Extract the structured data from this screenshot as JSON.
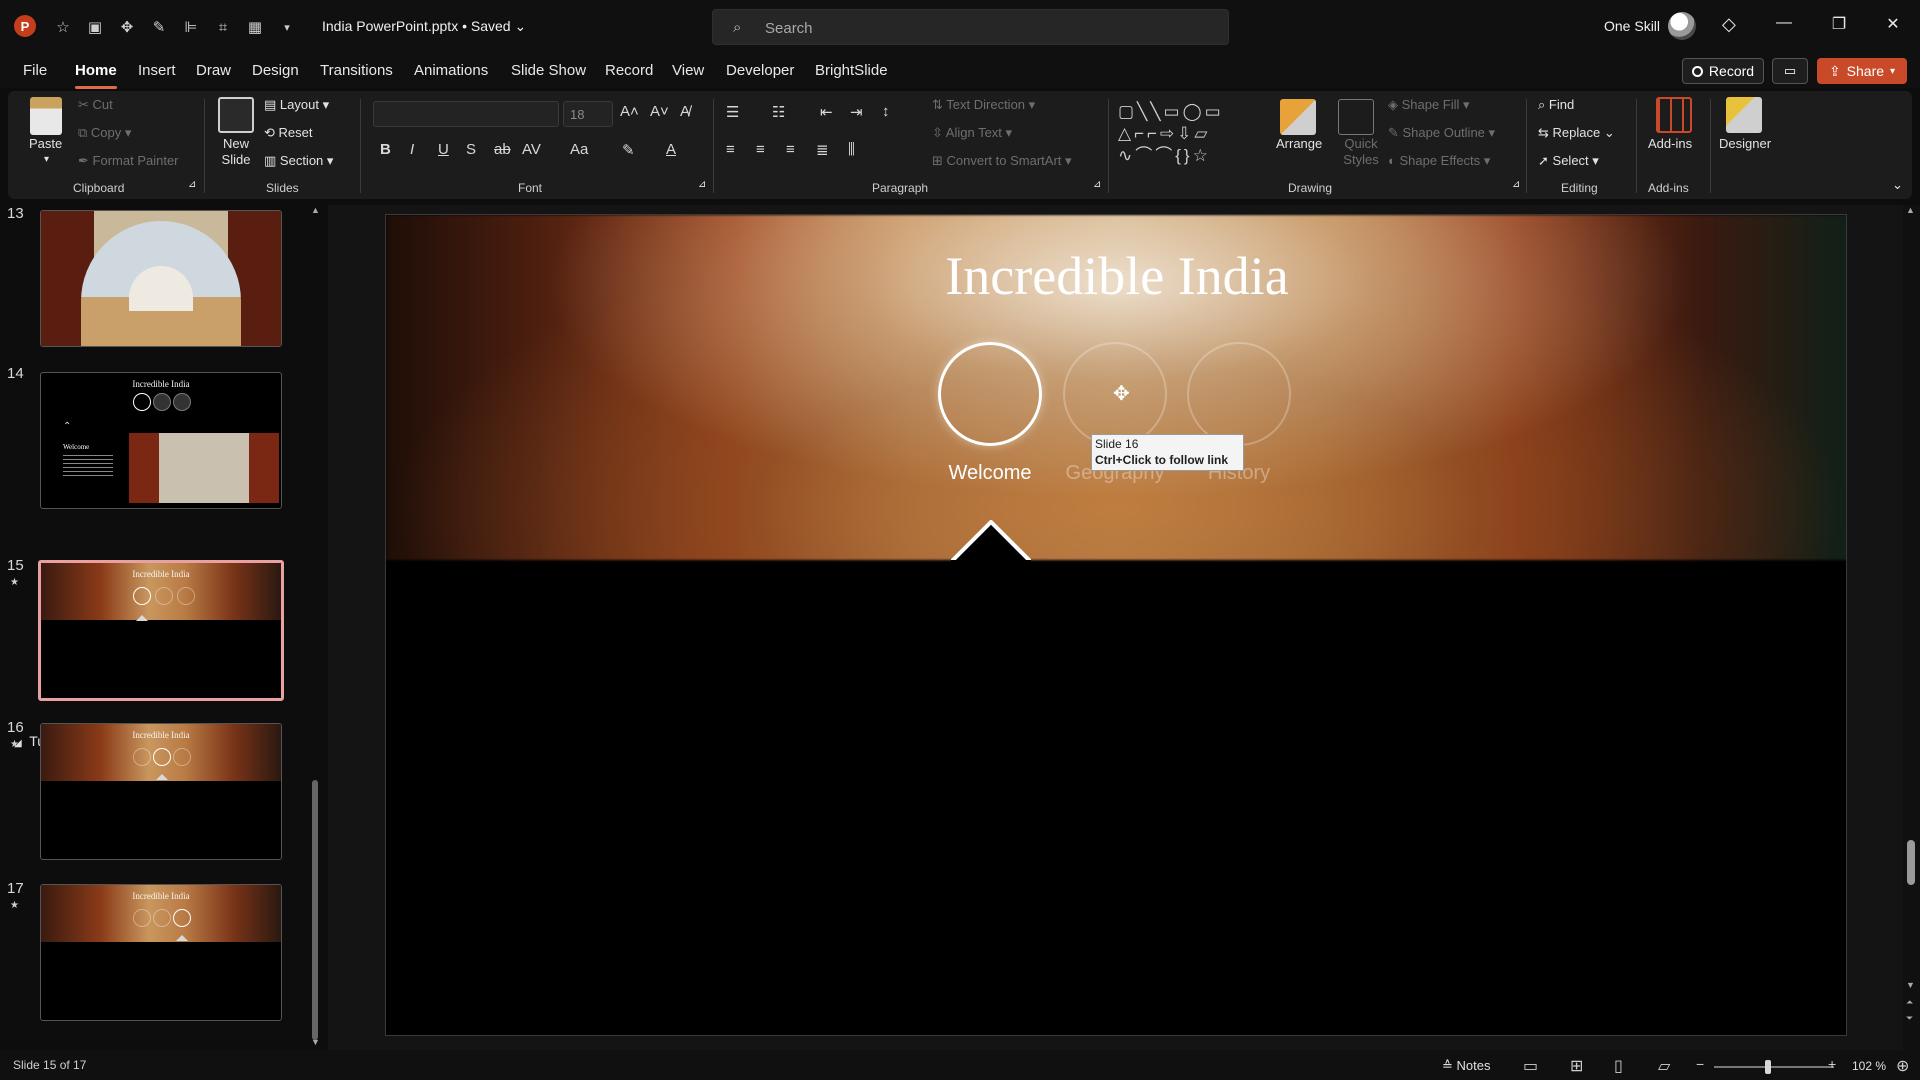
{
  "titlebar": {
    "app_logo": "P",
    "document_title": "India PowerPoint.pptx • Saved",
    "search_placeholder": "Search",
    "user_name": "One Skill"
  },
  "menu": {
    "tabs": [
      "File",
      "Home",
      "Insert",
      "Draw",
      "Design",
      "Transitions",
      "Animations",
      "Slide Show",
      "Record",
      "View",
      "Developer",
      "BrightSlide"
    ],
    "active_tab": "Home",
    "record_button": "Record",
    "share_button": "Share"
  },
  "ribbon": {
    "clipboard": {
      "paste": "Paste",
      "cut": "Cut",
      "copy": "Copy",
      "format_painter": "Format Painter",
      "label": "Clipboard"
    },
    "slides": {
      "new_slide": "New Slide",
      "layout": "Layout",
      "reset": "Reset",
      "section": "Section",
      "label": "Slides"
    },
    "font": {
      "font_size": "18",
      "label": "Font"
    },
    "paragraph": {
      "text_direction": "Text Direction",
      "align_text": "Align Text",
      "convert_smartart": "Convert to SmartArt",
      "label": "Paragraph"
    },
    "drawing": {
      "arrange": "Arrange",
      "quick_styles": "Quick Styles",
      "shape_fill": "Shape Fill",
      "shape_outline": "Shape Outline",
      "shape_effects": "Shape Effects",
      "label": "Drawing"
    },
    "editing": {
      "find": "Find",
      "replace": "Replace",
      "select": "Select",
      "label": "Editing"
    },
    "addins": {
      "addins": "Add-ins",
      "label": "Add-ins"
    },
    "designer": {
      "designer": "Designer"
    }
  },
  "thumbnails": {
    "section_name": "Tutorial",
    "slides": [
      {
        "number": "13"
      },
      {
        "number": "14",
        "title": "Incredible India",
        "welcome_heading": "Welcome"
      },
      {
        "number": "15",
        "title": "Incredible India",
        "selected": true
      },
      {
        "number": "16",
        "title": "Incredible India"
      },
      {
        "number": "17",
        "title": "Incredible India"
      }
    ]
  },
  "slide": {
    "title": "Incredible India",
    "nav": [
      {
        "label": "Welcome",
        "active": true
      },
      {
        "label": "Geography",
        "active": false
      },
      {
        "label": "History",
        "active": false
      }
    ]
  },
  "tooltip": {
    "line1": "Slide 16",
    "line2": "Ctrl+Click to follow link"
  },
  "statusbar": {
    "slide_info": "Slide 15 of 17",
    "notes": "Notes",
    "zoom": "102 %"
  },
  "colors": {
    "accent": "#c94a28",
    "tab_underline": "#e06b4a",
    "selected_thumb_border": "#e8a0a0"
  }
}
